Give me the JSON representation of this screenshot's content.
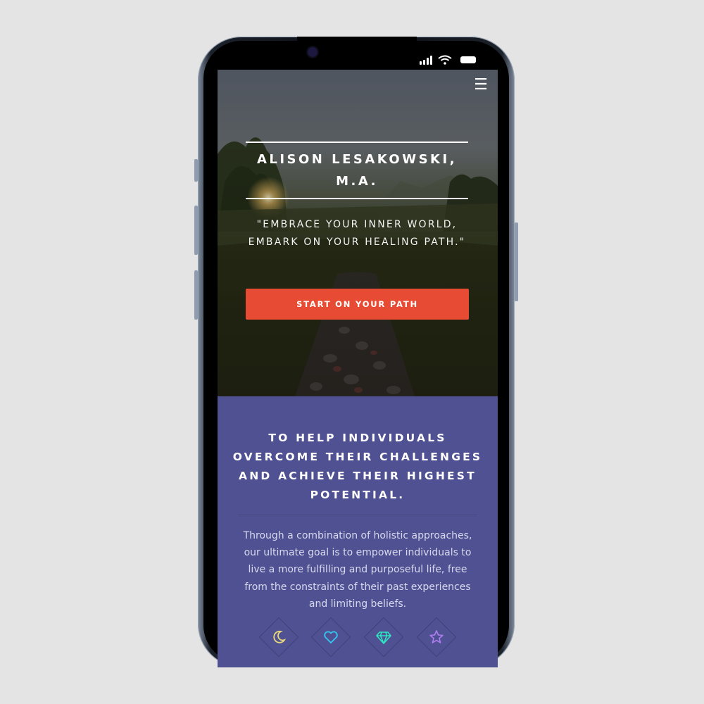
{
  "status_bar": {
    "signal_icon": "signal-icon",
    "wifi_icon": "wifi-icon",
    "battery_icon": "battery-icon"
  },
  "hero": {
    "menu_icon": "hamburger-menu-icon",
    "title_line1": "ALISON LESAKOWSKI,",
    "title_line2": "M.A.",
    "quote": "\"EMBRACE YOUR INNER WORLD, EMBARK ON YOUR HEALING PATH.\"",
    "cta_label": "START ON YOUR PATH"
  },
  "mission": {
    "title": "TO HELP INDIVIDUALS OVERCOME THEIR CHALLENGES AND ACHIEVE THEIR HIGHEST POTENTIAL.",
    "text": "Through a combination of holistic approaches, our ultimate goal is to empower individuals to live a more fulfilling and purposeful life, free from the constraints of their past experiences and limiting beliefs."
  },
  "features": [
    {
      "icon": "moon-icon",
      "color": "#e8d67a"
    },
    {
      "icon": "heart-icon",
      "color": "#33c8f0"
    },
    {
      "icon": "diamond-icon",
      "color": "#2ee6c2"
    },
    {
      "icon": "star-icon",
      "color": "#b07cf0"
    }
  ],
  "colors": {
    "background": "#e4e4e4",
    "section": "#4f5192",
    "cta": "#e84b33"
  }
}
